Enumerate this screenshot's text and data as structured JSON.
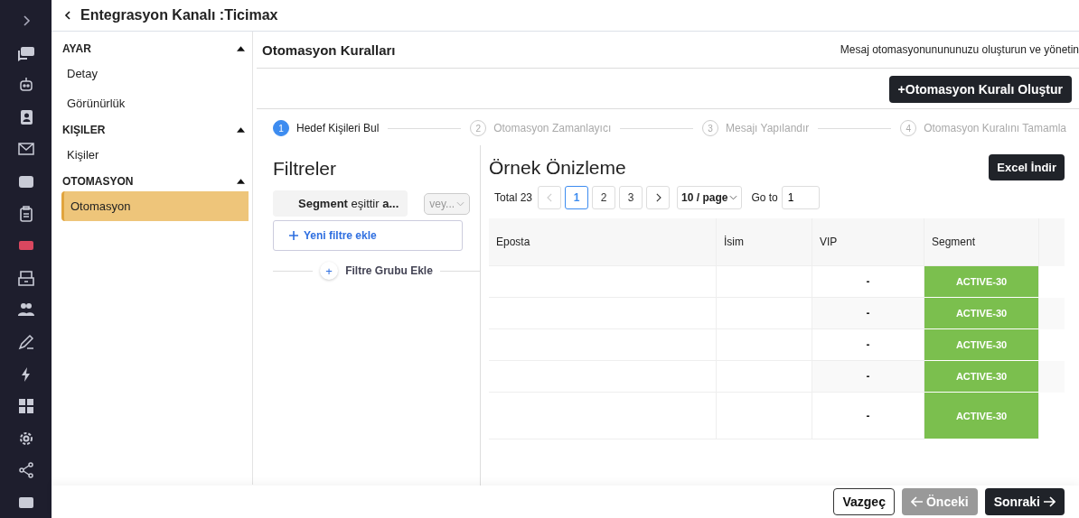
{
  "header": {
    "title": "Entegrasyon Kanalı :Ticimax"
  },
  "sidebar": {
    "groups": [
      {
        "title": "AYAR",
        "expanded": true,
        "items": [
          {
            "label": "Detay",
            "selected": false
          },
          {
            "label": "Görünürlük",
            "selected": false
          }
        ]
      },
      {
        "title": "KIŞILER",
        "expanded": true,
        "items": [
          {
            "label": "Kişiler",
            "selected": false
          }
        ]
      },
      {
        "title": "OTOMASYON",
        "expanded": true,
        "items": [
          {
            "label": "Otomasyon",
            "selected": true
          }
        ]
      }
    ]
  },
  "panel": {
    "title": "Otomasyon Kuralları",
    "subtitle": "Mesaj otomasyonunununuzu oluşturun ve yönetin",
    "create_button": "+Otomasyon Kuralı Oluştur"
  },
  "steps": [
    {
      "number": "1",
      "label": "Hedef Kişileri Bul",
      "selected": true
    },
    {
      "number": "2",
      "label": "Otomasyon Zamanlayıcı",
      "selected": false
    },
    {
      "number": "3",
      "label": "Mesajı Yapılandır",
      "selected": false
    },
    {
      "number": "4",
      "label": "Otomasyon Kuralını Tamamla",
      "selected": false
    }
  ],
  "filters": {
    "title": "Filtreler",
    "condition": "**Segment** eşittir **a...**",
    "operator": "vey...",
    "add_filter": "Yeni filtre ekle",
    "add_group_icon": "+",
    "add_group": "Filtre Grubu Ekle"
  },
  "preview": {
    "title": "Örnek Önizleme",
    "excel_button": "Excel İndir",
    "total": "Total 23",
    "pages": [
      {
        "label": "1",
        "selected": true
      },
      {
        "label": "2",
        "selected": false
      },
      {
        "label": "3",
        "selected": false
      }
    ],
    "prev_disabled": true,
    "page_size": "10 / page",
    "goto_label": "Go to",
    "goto_value": "1",
    "columns": [
      "Eposta",
      "İsim",
      "VIP",
      "Segment"
    ],
    "rows": [
      {
        "vip": "-",
        "segment": "ACTIVE-30",
        "color": "#7bbf4e"
      },
      {
        "vip": "-",
        "segment": "ACTIVE-30",
        "color": "#7bbf4e"
      },
      {
        "vip": "-",
        "segment": "ACTIVE-30",
        "color": "#7bbf4e"
      },
      {
        "vip": "-",
        "segment": "ACTIVE-30",
        "color": "#7bbf4e"
      },
      {
        "vip": "-",
        "segment": "ACTIVE-30",
        "color": "#7bbf4e"
      }
    ]
  },
  "footer": {
    "cancel": "Vazgeç",
    "previous": "Önceki",
    "previous_disabled": true,
    "next": "Sonraki"
  }
}
